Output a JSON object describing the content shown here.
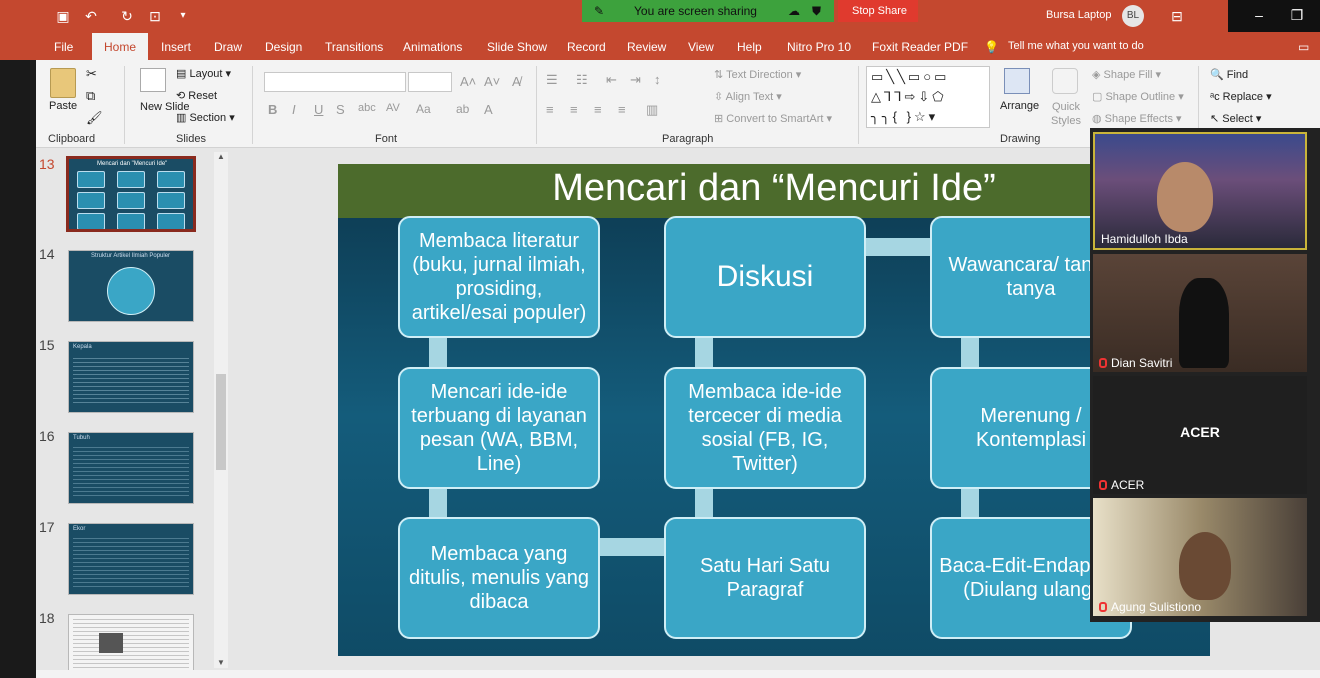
{
  "titlebar": {
    "share_status": "You are screen sharing",
    "stop_share": "Stop Share",
    "app_title": "Bursa Laptop",
    "avatar_initials": "BL"
  },
  "tabs": [
    "File",
    "Home",
    "Insert",
    "Draw",
    "Design",
    "Transitions",
    "Animations",
    "Slide Show",
    "Record",
    "Review",
    "View",
    "Help",
    "Nitro Pro 10",
    "Foxit Reader PDF"
  ],
  "tell_me": "Tell me what you want to do",
  "ribbon": {
    "clipboard": {
      "paste": "Paste",
      "label": "Clipboard"
    },
    "slides": {
      "new_slide": "New Slide",
      "layout": "Layout",
      "reset": "Reset",
      "section": "Section",
      "label": "Slides"
    },
    "font": {
      "label": "Font"
    },
    "paragraph": {
      "text_direction": "Text Direction",
      "align_text": "Align Text",
      "convert_smartart": "Convert to SmartArt",
      "label": "Paragraph"
    },
    "drawing": {
      "arrange": "Arrange",
      "quick_styles": "Quick Styles",
      "shape_fill": "Shape Fill",
      "shape_outline": "Shape Outline",
      "shape_effects": "Shape Effects",
      "label": "Drawing"
    },
    "editing": {
      "find": "Find",
      "replace": "Replace",
      "select": "Select"
    }
  },
  "thumbnails": [
    {
      "num": "13",
      "title": "Mencari dan \"Mencuri Ide\""
    },
    {
      "num": "14",
      "title": "Struktur Artikel Ilmiah Populer"
    },
    {
      "num": "15",
      "title": "Kepala"
    },
    {
      "num": "16",
      "title": "Tubuh"
    },
    {
      "num": "17",
      "title": "Ekor"
    },
    {
      "num": "18",
      "title": ""
    }
  ],
  "slide": {
    "title": "Mencari dan “Mencuri Ide”",
    "boxes": [
      "Membaca literatur (buku, jurnal ilmiah, prosiding, artikel/esai populer)",
      "Diskusi",
      "Wawancara/ tanya tanya",
      "Mencari ide-ide terbuang di layanan pesan (WA, BBM, Line)",
      "Membaca ide-ide tercecer di media sosial (FB, IG, Twitter)",
      "Merenung / Kontemplasi",
      "Membaca yang ditulis, menulis yang dibaca",
      "Satu Hari Satu Paragraf",
      "Baca-Edit-Endapkan (Diulang ulang)"
    ]
  },
  "participants": [
    {
      "name": "Hamidulloh Ibda",
      "muted": false
    },
    {
      "name": "Dian Savitri",
      "muted": true
    },
    {
      "name": "ACER",
      "muted": true,
      "label": "ACER"
    },
    {
      "name": "Agung Sulistiono",
      "muted": true
    }
  ]
}
